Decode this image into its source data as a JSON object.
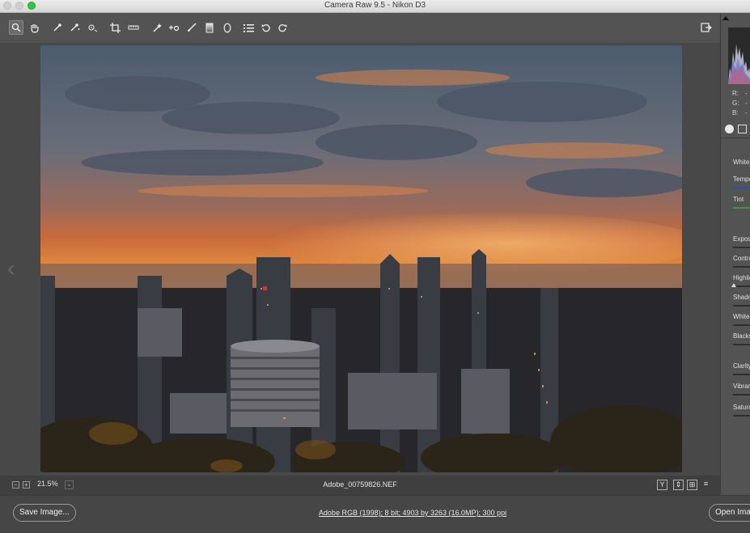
{
  "window": {
    "title": "Camera Raw 9.5  -  Nikon D3"
  },
  "toolbar": {
    "tools": [
      "zoom-tool",
      "hand-tool",
      "white-balance-tool",
      "color-sampler-tool",
      "targeted-adjustment-tool",
      "crop-tool",
      "straighten-tool",
      "transform-tool",
      "spot-removal-tool",
      "red-eye-tool",
      "adjustment-brush-tool",
      "graduated-filter-tool",
      "radial-filter-tool",
      "preferences-tool",
      "rotate-ccw-tool",
      "rotate-cw-tool"
    ],
    "fullscreen_icon": "fullscreen-icon"
  },
  "status": {
    "zoom_out_glyph": "−",
    "zoom_in_glyph": "+",
    "zoom": "21.5%",
    "filename": "Adobe_00759826.NEF",
    "view_glyphs": [
      "Y",
      "⇕",
      "⊞",
      "≡"
    ]
  },
  "bottom": {
    "save_label": "Save Image...",
    "workflow": "Adobe RGB (1998); 8 bit; 4903 by 3263 (16.0MP); 300 ppi",
    "open_label": "Open Image"
  },
  "histogram_readout": {
    "r": "R:",
    "g": "G:",
    "b": "B:",
    "dash": "-"
  },
  "panel": {
    "labels": [
      "White Balance",
      "Temperature",
      "Tint",
      "Exposure",
      "Contrast",
      "Highlights",
      "Shadows",
      "Whites",
      "Blacks",
      "Clarity",
      "Vibrance",
      "Saturation"
    ]
  },
  "colors": {
    "window_bg": "#4a4a4a",
    "panel_bg": "#535353",
    "temperature_slider": "#2a4fb0",
    "tint_slider": "#3a9a3a"
  }
}
